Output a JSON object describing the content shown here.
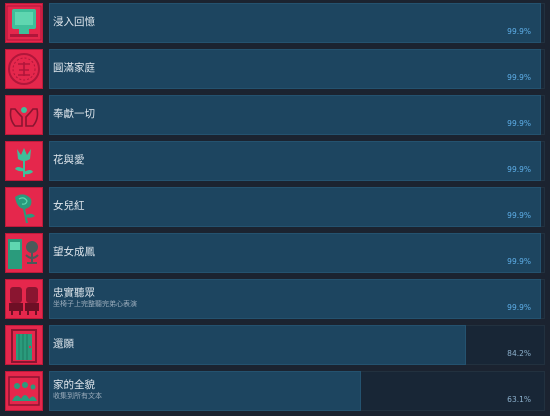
{
  "achievements": [
    {
      "title": "浸入回憶",
      "description": "",
      "percent": "99.9%",
      "progress": 0.999,
      "icon": "tv-screen-icon"
    },
    {
      "title": "圓滿家庭",
      "description": "",
      "percent": "99.9%",
      "progress": 0.999,
      "icon": "round-emblem-icon"
    },
    {
      "title": "奉獻一切",
      "description": "",
      "percent": "99.9%",
      "progress": 0.999,
      "icon": "cupped-hands-icon"
    },
    {
      "title": "花與愛",
      "description": "",
      "percent": "99.9%",
      "progress": 0.999,
      "icon": "flower-icon"
    },
    {
      "title": "女兒紅",
      "description": "",
      "percent": "99.9%",
      "progress": 0.999,
      "icon": "rose-icon"
    },
    {
      "title": "望女成鳳",
      "description": "",
      "percent": "99.9%",
      "progress": 0.999,
      "icon": "microphone-icon"
    },
    {
      "title": "忠實聽眾",
      "description": "坐椅子上完整聽完弟心表演",
      "percent": "99.9%",
      "progress": 0.999,
      "icon": "theater-seats-icon"
    },
    {
      "title": "還願",
      "description": "",
      "percent": "84.2%",
      "progress": 0.842,
      "icon": "door-icon"
    },
    {
      "title": "家的全貌",
      "description": "收集到所有文本",
      "percent": "63.1%",
      "progress": 0.631,
      "icon": "family-photo-icon"
    }
  ],
  "colors": {
    "background": "#1b2330",
    "icon_bg": "#e5274c",
    "icon_art": "#3fbf9a",
    "bar_track": "#182636",
    "bar_fill": "#1d4560",
    "percent_text": "#5fb0ea"
  }
}
